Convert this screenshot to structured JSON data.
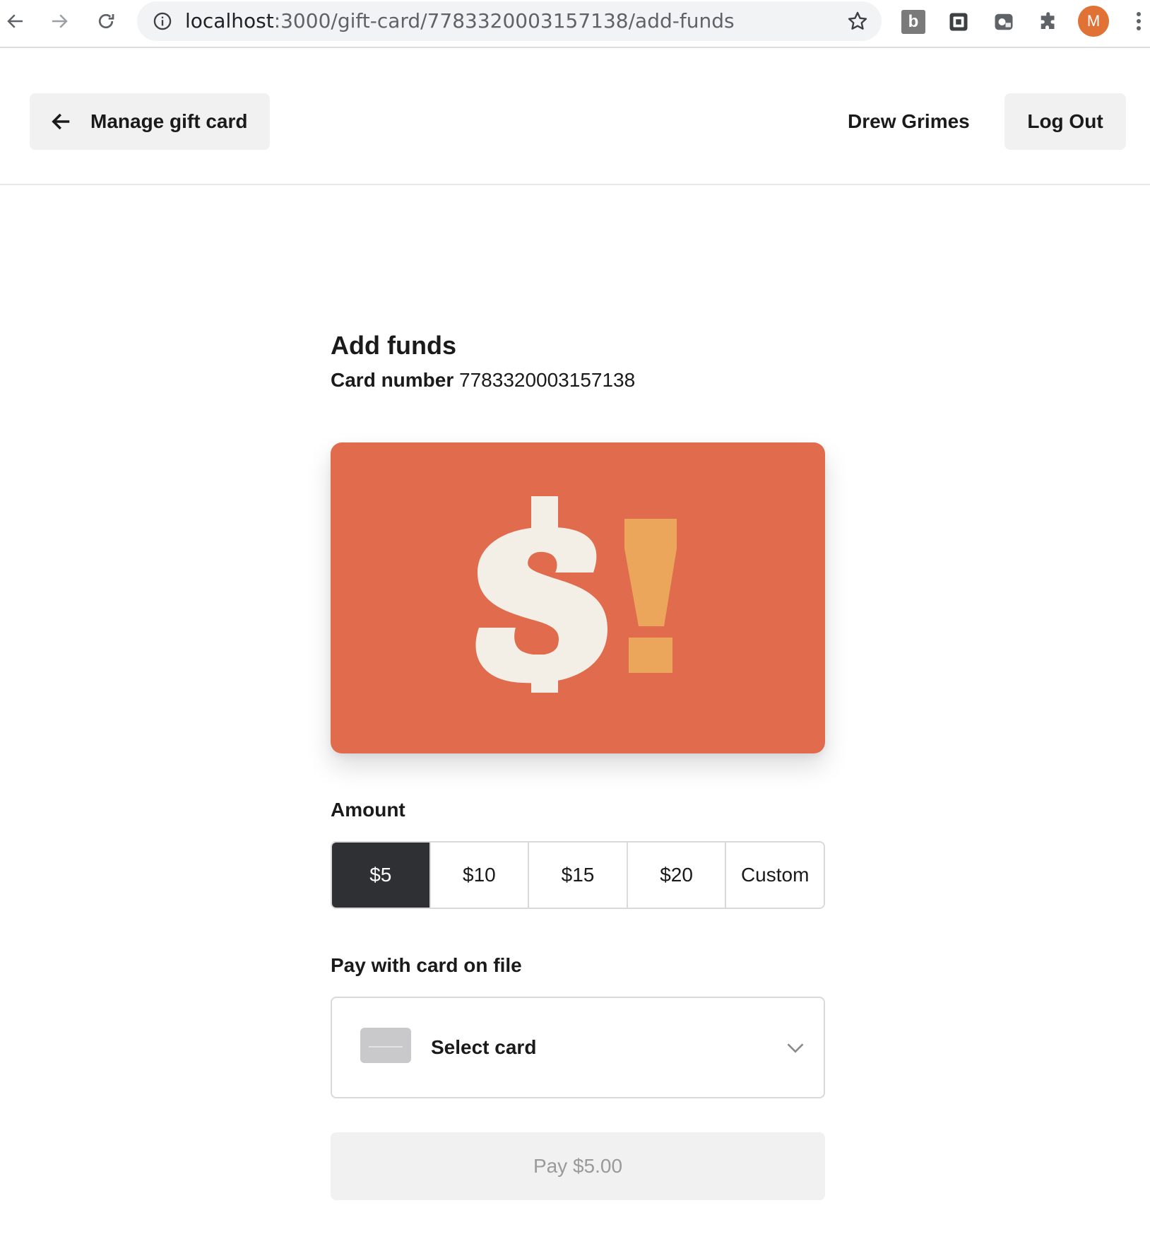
{
  "browser": {
    "url_host": "localhost",
    "url_path": ":3000/gift-card/7783320003157138/add-funds",
    "extension_b_label": "b",
    "profile_initial": "M",
    "icons": [
      "back-arrow-icon",
      "forward-arrow-icon",
      "reload-icon",
      "info-icon",
      "star-icon",
      "extension-b-icon",
      "square-extension-icon",
      "screen-extension-icon",
      "puzzle-icon",
      "kebab-menu-icon"
    ]
  },
  "header": {
    "back_label": "Manage gift card",
    "user_name": "Drew Grimes",
    "logout_label": "Log Out"
  },
  "main": {
    "title": "Add funds",
    "card_number_label": "Card number",
    "card_number_value": "7783320003157138",
    "card_colors": {
      "background": "#e06b4d",
      "dollar": "#f3efe6",
      "exclaim": "#eba65c"
    },
    "amount_label": "Amount",
    "amount_options": [
      "$5",
      "$10",
      "$15",
      "$20",
      "Custom"
    ],
    "selected_amount": "$5",
    "pay_label": "Pay with card on file",
    "select_placeholder": "Select card",
    "pay_button_label": "Pay $5.00"
  }
}
